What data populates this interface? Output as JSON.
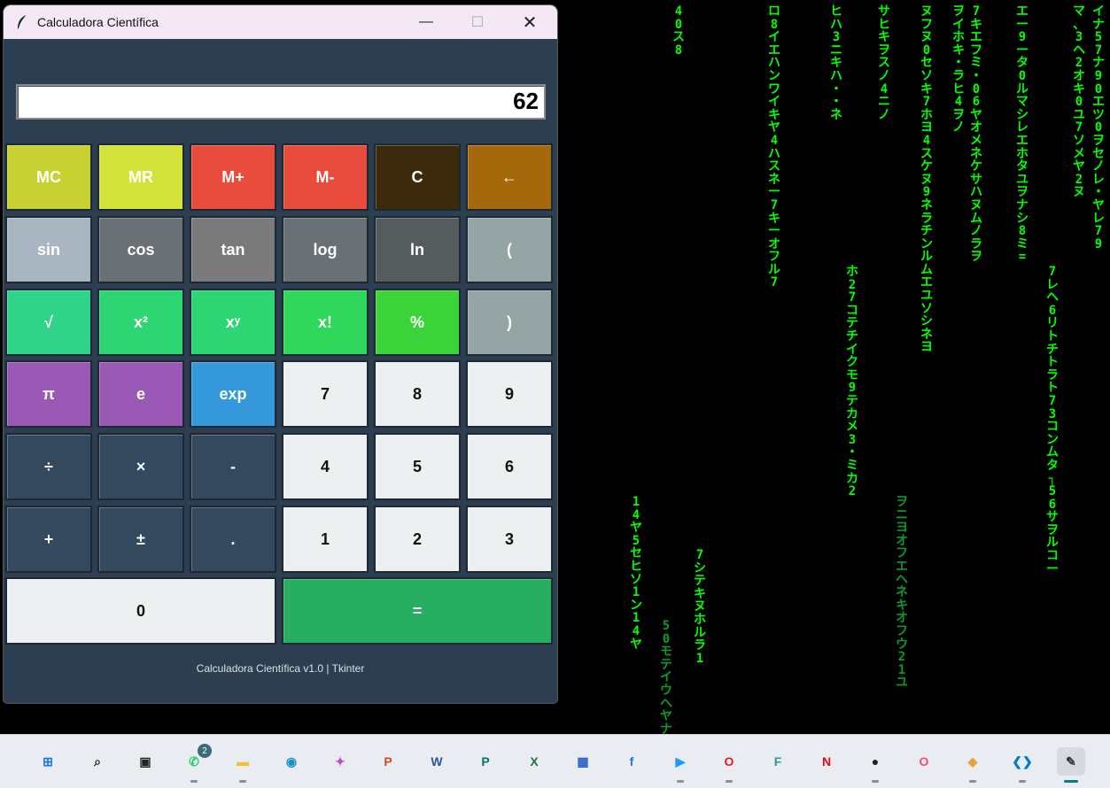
{
  "window": {
    "title": "Calculadora Científica",
    "controls": {
      "minimize": "—",
      "maximize": "☐",
      "close": "✕"
    }
  },
  "display": {
    "value": "62"
  },
  "keys": [
    {
      "label": "MC",
      "color": "#c7d131",
      "text": "#ffffff"
    },
    {
      "label": "MR",
      "color": "#d4e33a",
      "text": "#ffffff"
    },
    {
      "label": "M+",
      "color": "#e74c3c",
      "text": "#ffffff"
    },
    {
      "label": "M-",
      "color": "#e74c3c",
      "text": "#ffffff"
    },
    {
      "label": "C",
      "color": "#3d2a0d",
      "text": "#ffffff"
    },
    {
      "label": "←",
      "color": "#a5680b",
      "text": "#ffffff"
    },
    {
      "label": "sin",
      "color": "#a9b6c1",
      "text": "#ffffff"
    },
    {
      "label": "cos",
      "color": "#6a7176",
      "text": "#ffffff"
    },
    {
      "label": "tan",
      "color": "#7a7a7a",
      "text": "#ffffff"
    },
    {
      "label": "log",
      "color": "#6a7176",
      "text": "#ffffff"
    },
    {
      "label": "ln",
      "color": "#565b5e",
      "text": "#ffffff"
    },
    {
      "label": "(",
      "color": "#95a5a6",
      "text": "#ffffff"
    },
    {
      "label": "√",
      "color": "#2fd48a",
      "text": "#ffffff"
    },
    {
      "label": "x²",
      "color": "#2ed573",
      "text": "#ffffff"
    },
    {
      "label": "xʸ",
      "color": "#2ed573",
      "text": "#ffffff"
    },
    {
      "label": "x!",
      "color": "#2fd85a",
      "text": "#ffffff"
    },
    {
      "label": "%",
      "color": "#3cd43a",
      "text": "#ffffff"
    },
    {
      "label": ")",
      "color": "#95a5a6",
      "text": "#ffffff"
    },
    {
      "label": "π",
      "color": "#9b59b6",
      "text": "#ffffff"
    },
    {
      "label": "e",
      "color": "#9b59b6",
      "text": "#ffffff"
    },
    {
      "label": "exp",
      "color": "#3498db",
      "text": "#ffffff"
    },
    {
      "label": "7",
      "color": "#ecf0f1",
      "text": "#111111"
    },
    {
      "label": "8",
      "color": "#ecf0f1",
      "text": "#111111"
    },
    {
      "label": "9",
      "color": "#ecf0f1",
      "text": "#111111"
    },
    {
      "label": "÷",
      "color": "#34495e",
      "text": "#ffffff"
    },
    {
      "label": "×",
      "color": "#34495e",
      "text": "#ffffff"
    },
    {
      "label": "-",
      "color": "#34495e",
      "text": "#ffffff"
    },
    {
      "label": "4",
      "color": "#ecf0f1",
      "text": "#111111"
    },
    {
      "label": "5",
      "color": "#ecf0f1",
      "text": "#111111"
    },
    {
      "label": "6",
      "color": "#ecf0f1",
      "text": "#111111"
    },
    {
      "label": "+",
      "color": "#34495e",
      "text": "#ffffff"
    },
    {
      "label": "±",
      "color": "#34495e",
      "text": "#ffffff"
    },
    {
      "label": ".",
      "color": "#34495e",
      "text": "#ffffff"
    },
    {
      "label": "1",
      "color": "#ecf0f1",
      "text": "#111111"
    },
    {
      "label": "2",
      "color": "#ecf0f1",
      "text": "#111111"
    },
    {
      "label": "3",
      "color": "#ecf0f1",
      "text": "#111111"
    },
    {
      "label": "0",
      "color": "#ecf0f1",
      "text": "#111111"
    },
    {
      "label": "=",
      "color": "#27ae60",
      "text": "#ffffff"
    }
  ],
  "footer": "Calculadora Científica v1.0 | Tkinter",
  "taskbar": {
    "items": [
      {
        "name": "start",
        "glyph": "⊞",
        "color": "#1a73e8"
      },
      {
        "name": "search",
        "glyph": "⌕",
        "color": "#222"
      },
      {
        "name": "task-view",
        "glyph": "▣",
        "color": "#222"
      },
      {
        "name": "whatsapp",
        "glyph": "✆",
        "color": "#25d366"
      },
      {
        "name": "file-explorer",
        "glyph": "▬",
        "color": "#f2c12e"
      },
      {
        "name": "edge",
        "glyph": "◉",
        "color": "#1e90c8"
      },
      {
        "name": "copilot",
        "glyph": "✦",
        "color": "#c04ad8"
      },
      {
        "name": "powerpoint",
        "glyph": "P",
        "color": "#d24726"
      },
      {
        "name": "word",
        "glyph": "W",
        "color": "#2b579a"
      },
      {
        "name": "publisher",
        "glyph": "P",
        "color": "#077568"
      },
      {
        "name": "excel",
        "glyph": "X",
        "color": "#217346"
      },
      {
        "name": "store",
        "glyph": "▦",
        "color": "#2a60c9"
      },
      {
        "name": "facebook",
        "glyph": "f",
        "color": "#1877f2"
      },
      {
        "name": "prime-video",
        "glyph": "▶",
        "color": "#1a98ff"
      },
      {
        "name": "opera",
        "glyph": "O",
        "color": "#e21b2a"
      },
      {
        "name": "teams",
        "glyph": "F",
        "color": "#1f9f8f"
      },
      {
        "name": "netflix",
        "glyph": "N",
        "color": "#e50914"
      },
      {
        "name": "github",
        "glyph": "●",
        "color": "#222"
      },
      {
        "name": "opera-gx",
        "glyph": "O",
        "color": "#f04e6a"
      },
      {
        "name": "app-colorful",
        "glyph": "◆",
        "color": "#e9a13b"
      },
      {
        "name": "vscode",
        "glyph": "❮❯",
        "color": "#007acc"
      },
      {
        "name": "python-feather",
        "glyph": "✎",
        "color": "#333"
      }
    ],
    "whatsapp_badge": "2"
  },
  "matrix": {
    "columns": [
      {
        "text": "4\n0\nス\n8",
        "style": "bright"
      },
      {
        "text": "ロ\n8\nイ\nエ\nハ\nン\nワ\nイ\nキ\nヤ\n4\nハ\nス\nネ\nー\n7\nキ\nー\nオ\nフ\nル\n7",
        "style": "bright"
      },
      {
        "text": "ヒ\nハ\n3\nニ\nキ\nハ\n・\n・\nネ",
        "style": "bright"
      },
      {
        "text": "サ\nヒ\nキ\nヲ\nス\nノ\n4\nニ\nノ",
        "style": "bright"
      },
      {
        "text": "ヲ\nイ\nホ\nキ\n・\nラ\nヒ\n4\nヲ\nノ",
        "style": "bright"
      },
      {
        "text": "7\nキ\nエ\nフ\nミ\n・\n0\n6\nヤ\nオ\nメ\nネ\nケ\nサ\nハ\nヌ\nム\nノ\nラ\nヲ",
        "style": "bright"
      },
      {
        "text": "エ\nー\n9\nー\nタ\n0\nル\nマ\nシ\nレ\nエ\nホ\nタ\nユ\nヲ\nナ\nシ\n8\nミ\n=",
        "style": "bright"
      },
      {
        "text": "マ\n、\n3\nヘ\n2\nオ\nキ\n0\nユ\n7\nソ\nメ\nヤ\n2\nヌ",
        "style": "bright"
      },
      {
        "text": "イ\nナ\n5\n7\nナ\n9\n0\nエ\nツ\n0\nヲ\nセ\nノ\nレ\n・\nヤ\nレ\n7\n9",
        "style": "bright"
      },
      {
        "text": "ヌ\nフ\nヌ\n0\nセ\nソ\nキ\n7\nホ\nヨ\n4\nス\nケ\nヌ\n9\nネ\nラ\nチ\nン\nル\nム\nエ\nユ\nソ\nシ\nネ\nヨ",
        "style": "bright"
      },
      {
        "text": "ホ\n2\n7\nコ\nテ\nチ\nイ\nク\nモ\n9\nテ\nカ\nメ\n3\n・\nミ\nカ\n2",
        "style": "bright"
      },
      {
        "text": "7\nレ\nヘ\n6\nリ\nト\nチ\nト\nラ\nト\n7\n3\nコ\nン\nム\nタ\n┐\n5\n6\nサ\nヲ\nル\nコ\nー",
        "style": "bright"
      },
      {
        "text": "1\n4\nヤ\n5\nセ\nヒ\nソ\n1\nン\n1\n4\nヤ",
        "style": "bright"
      },
      {
        "text": "7\nシ\nテ\nキ\nヌ\nホ\nル\nラ\n1",
        "style": "bright"
      },
      {
        "text": "ヲ\nニ\nヨ\nオ\nフ\nエ\nヘ\nネ\nキ\nオ\nフ\nウ\n2\n1\nユ",
        "style": "mid"
      },
      {
        "text": "5\n0\nモ\nテ\nイ\nウ\nヘ\nヤ\nナ",
        "style": "mid"
      }
    ]
  }
}
